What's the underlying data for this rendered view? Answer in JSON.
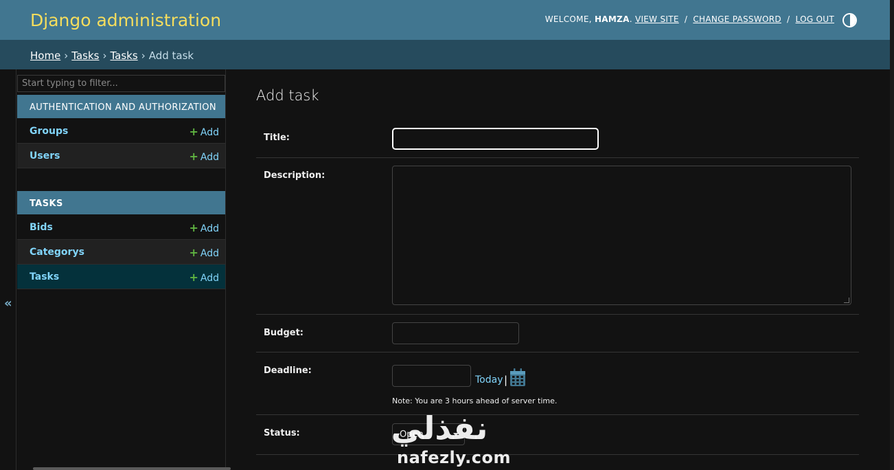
{
  "header": {
    "site_name": "Django administration",
    "welcome": "Welcome,",
    "username": "hamza",
    "view_site": "View site",
    "change_password": "Change password",
    "log_out": "Log out",
    "separator": "/"
  },
  "breadcrumbs": {
    "home": "Home",
    "app": "Tasks",
    "model": "Tasks",
    "current": "Add task",
    "separator": "›"
  },
  "sidebar": {
    "filter_placeholder": "Start typing to filter...",
    "collapse_symbol": "«",
    "add_label": "Add",
    "modules": [
      {
        "caption": "Authentication and Authorization",
        "models": [
          {
            "name": "Groups"
          },
          {
            "name": "Users"
          }
        ]
      },
      {
        "caption": "Tasks",
        "models": [
          {
            "name": "Bids"
          },
          {
            "name": "Categorys"
          },
          {
            "name": "Tasks",
            "current": true
          }
        ]
      }
    ]
  },
  "main": {
    "title": "Add task",
    "fields": {
      "title": {
        "label": "Title:",
        "value": ""
      },
      "description": {
        "label": "Description:",
        "value": ""
      },
      "budget": {
        "label": "Budget:",
        "value": ""
      },
      "deadline": {
        "label": "Deadline:",
        "value": "",
        "today_link": "Today",
        "link_separator": "|",
        "timezone_note": "Note: You are 3 hours ahead of server time."
      },
      "status": {
        "label": "Status:",
        "selected": "Open"
      }
    }
  },
  "watermark": {
    "word": "نفذلي",
    "domain": "nafezly.com"
  },
  "colors": {
    "header_bg": "#417690",
    "breadcrumbs_bg": "#264b5d",
    "site_name": "#f5dd5d",
    "link": "#81d4fa",
    "add_plus": "#5fb341",
    "current_row": "#04313b",
    "page_bg": "#121212"
  }
}
